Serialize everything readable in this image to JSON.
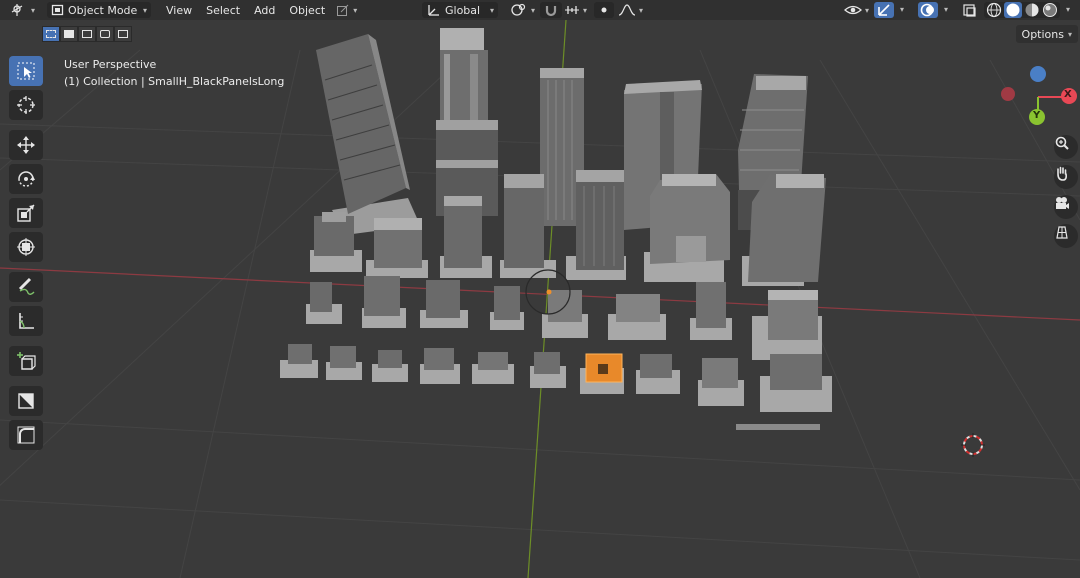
{
  "header": {
    "editor_type_icon": "3d-viewport-icon",
    "mode": "Object Mode",
    "menus": [
      "View",
      "Select",
      "Add",
      "Object"
    ],
    "transform_orientation": "Global",
    "pivot_icon": "pivot-point-icon",
    "snap_icon": "snap-magnet-icon",
    "proportional_icon": "proportional-editing-icon"
  },
  "subheader": {
    "options_label": "Options"
  },
  "viewport": {
    "perspective_label": "User Perspective",
    "collection_label": "(1) Collection | SmallH_BlackPanelsLong"
  },
  "gizmo": {
    "axis_x": "X",
    "axis_y": "Y",
    "x_color": "#e84855",
    "y_color": "#8ac330",
    "z_color": "#4a7fc6"
  },
  "toolbar": {
    "tools": [
      "select-box",
      "cursor",
      "move",
      "rotate",
      "scale",
      "transform",
      "annotate",
      "measure",
      "add-cube",
      "extrude",
      "bevel"
    ],
    "active_tool": "select-box"
  },
  "colors": {
    "accent": "#4772b3",
    "selection": "#f0902a",
    "background": "#3a3a3a",
    "header": "#303030"
  }
}
